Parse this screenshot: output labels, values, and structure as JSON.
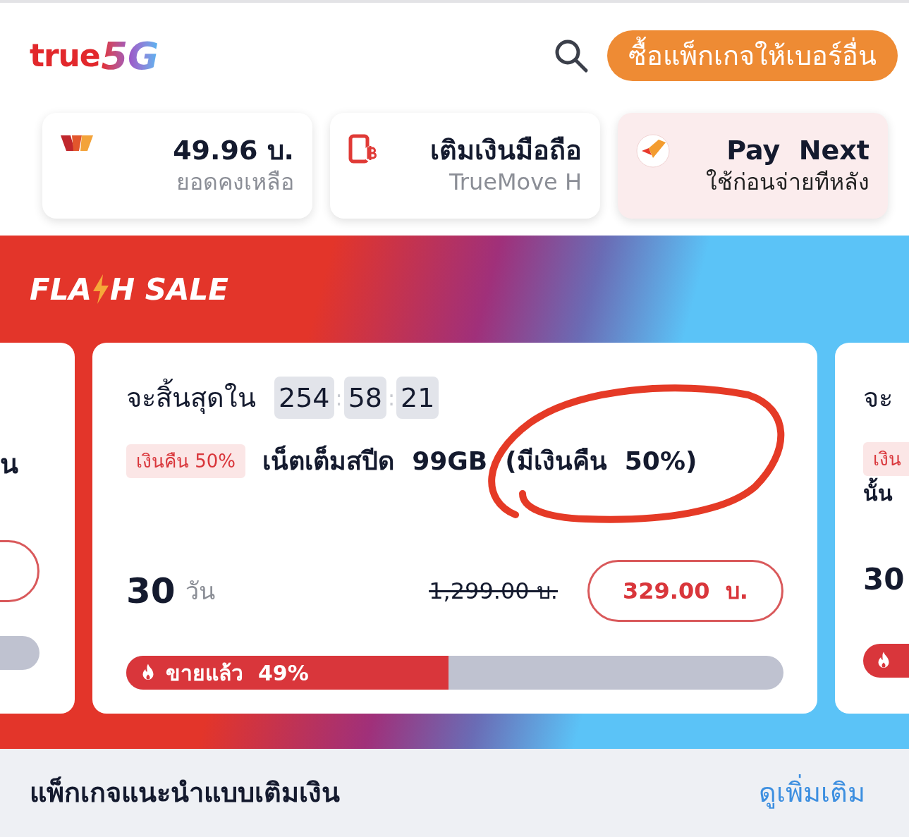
{
  "header": {
    "logo_word": "true",
    "logo_badge": "5G",
    "buy_button": "ซื้อแพ็กเกจให้เบอร์อื่น"
  },
  "shortcuts": [
    {
      "kind": "wallet",
      "title": "49.96 บ.",
      "subtitle": "ยอดคงเหลือ"
    },
    {
      "kind": "topup",
      "title": "เติมเงินมือถือ",
      "subtitle": "TrueMove H"
    },
    {
      "kind": "paynext",
      "title": "Pay  Next",
      "subtitle": "ใช้ก่อนจ่ายทีหลัง"
    }
  ],
  "flash_sale": {
    "title_before": "FLA",
    "title_after": "H SALE",
    "left_card": {
      "title_fragment": "น"
    },
    "main_card": {
      "ends_label": "จะสิ้นสุดใน",
      "countdown": [
        "254",
        "58",
        "21"
      ],
      "countdown_separator": ":",
      "tag": "เงินคืน 50%",
      "title": "เน็ตเต็มสปีด  99GB  (มีเงินคืน  50%)",
      "days": "30",
      "days_unit": "วัน",
      "old_price": "1,299.00 บ.",
      "price_button": "329.00  บ.",
      "sold_label": "ขายแล้ว  49%",
      "level": 0.49
    },
    "right_card": {
      "ends_fragment": "จะ",
      "tag_fragment": "เงิน",
      "title_fragment": "นั้น",
      "days": "30"
    }
  },
  "recommended": {
    "heading": "แพ็กเกจแนะนำแบบเติมเงิน",
    "more_link": "ดูเพิ่มเติม"
  }
}
